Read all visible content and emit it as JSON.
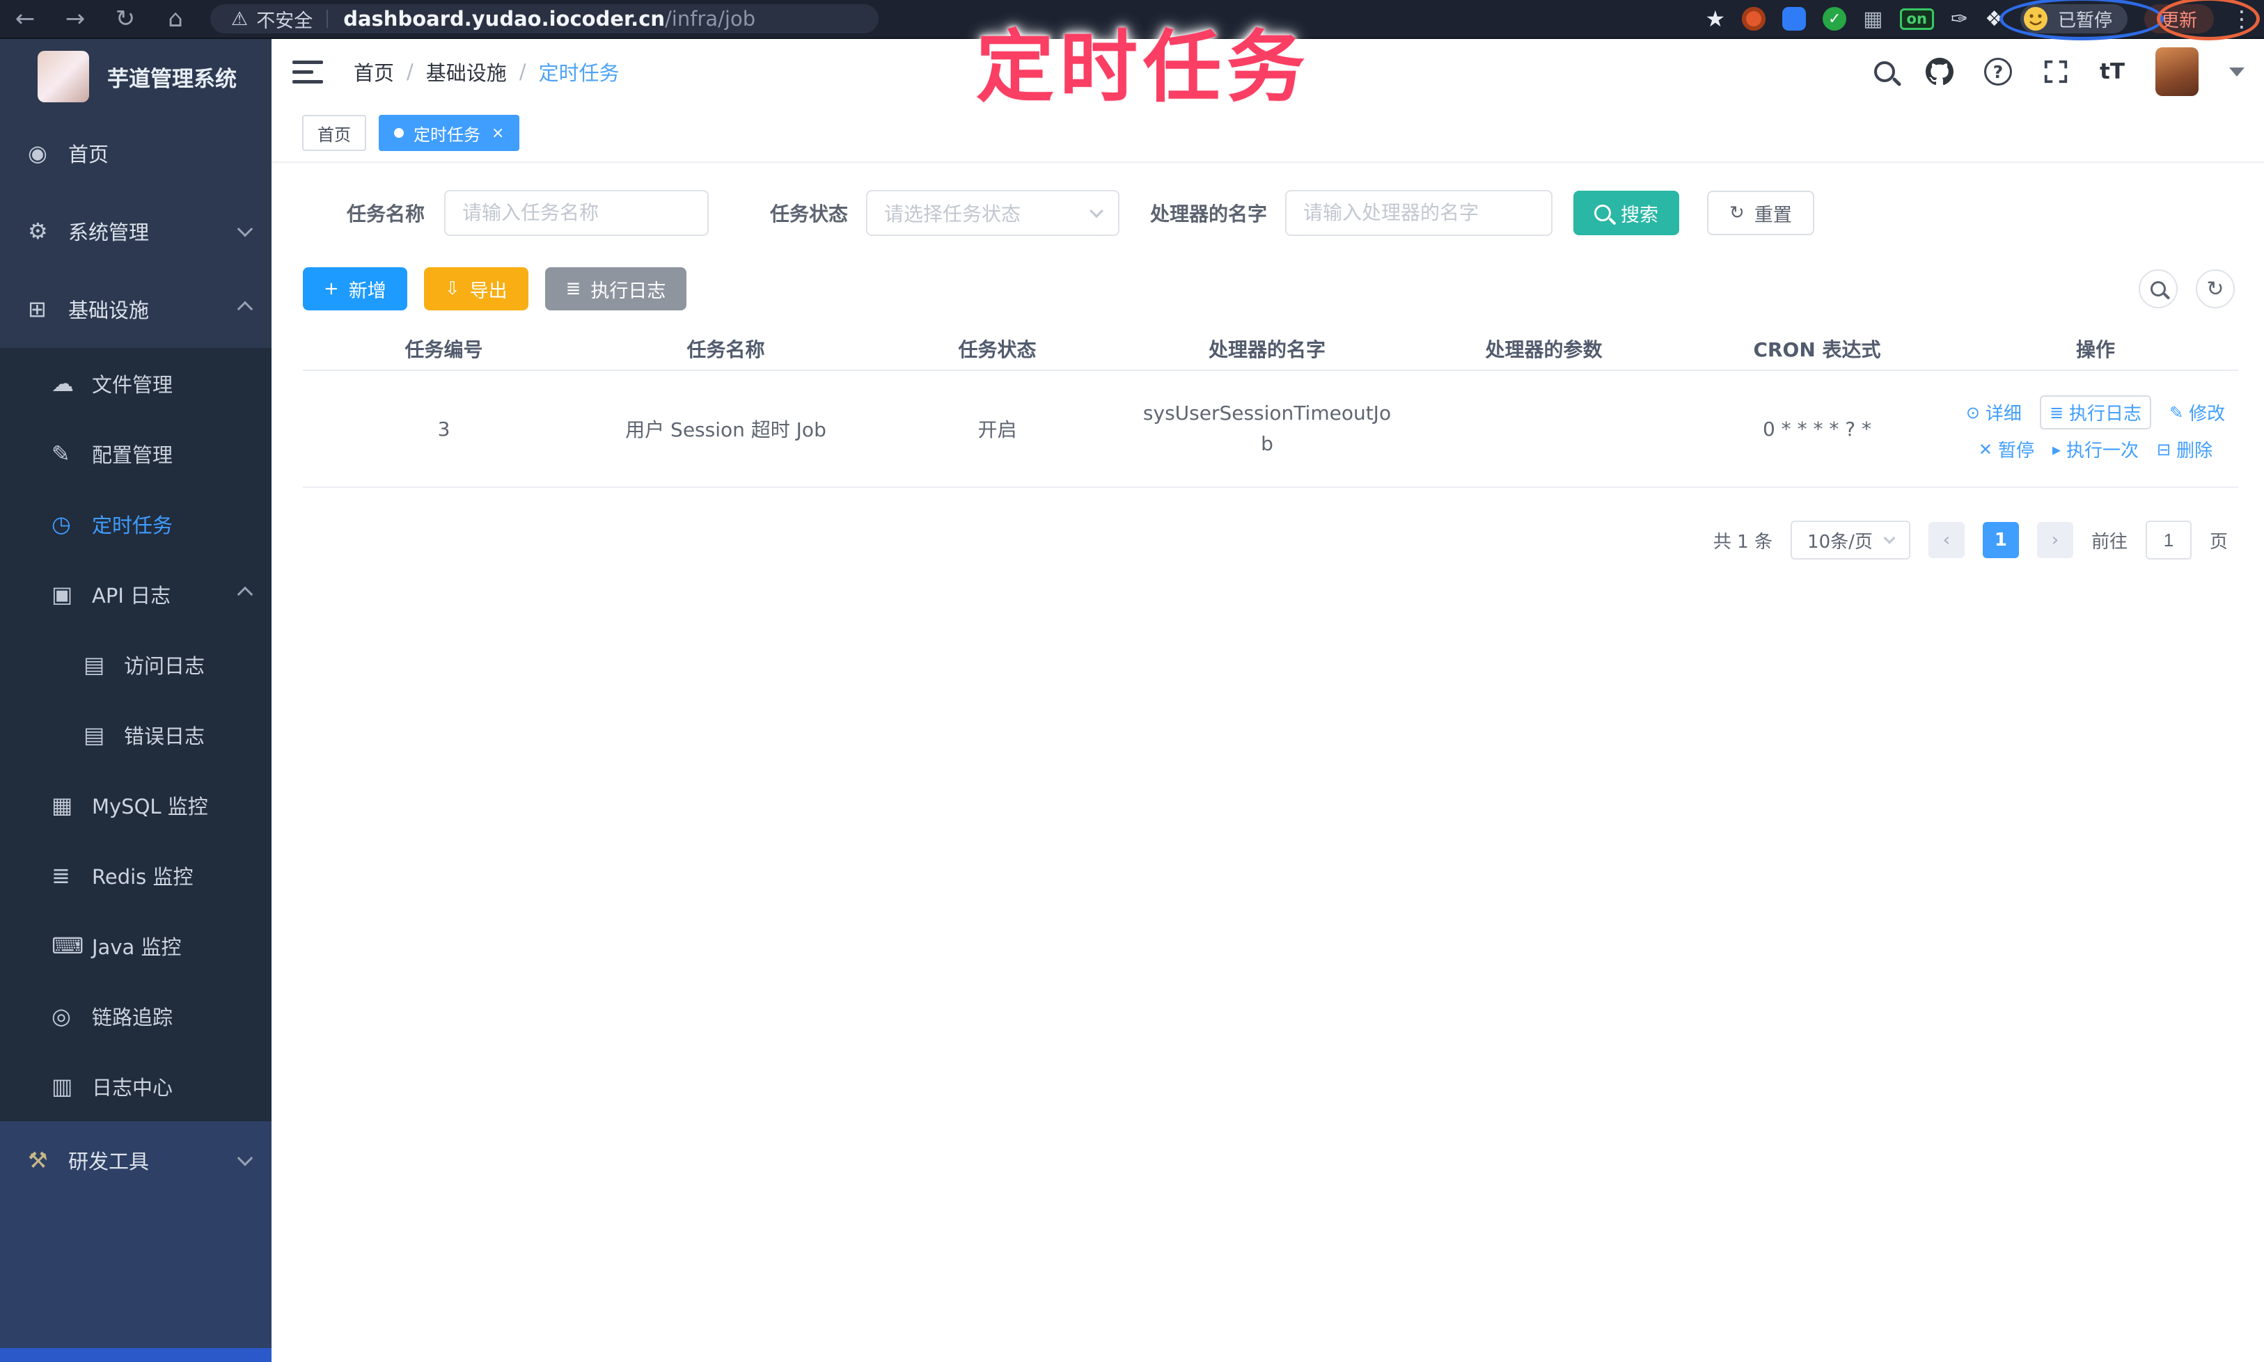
{
  "colors": {
    "primary": "#409eff",
    "search_teal": "#2ab7a5",
    "export_yellow": "#f9ae13",
    "info_gray": "#8f959f",
    "annotation_pink": "#fb3e63",
    "sidebar_bg": "#2c3950",
    "sidebar_sub_bg": "#212c3d"
  },
  "annotation": {
    "title": "定时任务"
  },
  "browser": {
    "security_label": "不安全",
    "url_host": "dashboard.yudao.iocoder.cn",
    "url_path": "/infra/job",
    "on_badge": "on",
    "profile_status": "已暂停",
    "update_label": "更新"
  },
  "sidebar": {
    "app_title": "芋道管理系统",
    "items": [
      {
        "icon": "◉",
        "label": "首页"
      },
      {
        "icon": "⚙",
        "label": "系统管理"
      },
      {
        "icon": "⊞",
        "label": "基础设施"
      },
      {
        "icon": "☁",
        "label": "文件管理"
      },
      {
        "icon": "✎",
        "label": "配置管理"
      },
      {
        "icon": "◷",
        "label": "定时任务"
      },
      {
        "icon": "▣",
        "label": "API 日志"
      },
      {
        "icon": "▤",
        "label": "访问日志"
      },
      {
        "icon": "▤",
        "label": "错误日志"
      },
      {
        "icon": "▦",
        "label": "MySQL 监控"
      },
      {
        "icon": "≣",
        "label": "Redis 监控"
      },
      {
        "icon": "⌨",
        "label": "Java 监控"
      },
      {
        "icon": "◎",
        "label": "链路追踪"
      },
      {
        "icon": "▥",
        "label": "日志中心"
      },
      {
        "icon": "⚒",
        "label": "研发工具"
      }
    ]
  },
  "header": {
    "breadcrumb": [
      "首页",
      "基础设施",
      "定时任务"
    ],
    "text_size_label": "tT"
  },
  "tags": {
    "items": [
      {
        "label": "首页"
      },
      {
        "label": "定时任务"
      }
    ]
  },
  "filters": {
    "name_label": "任务名称",
    "name_placeholder": "请输入任务名称",
    "status_label": "任务状态",
    "status_placeholder": "请选择任务状态",
    "handler_label": "处理器的名字",
    "handler_placeholder": "请输入处理器的名字",
    "search_label": "搜索",
    "reset_label": "重置"
  },
  "toolbar": {
    "add_label": "新增",
    "export_label": "导出",
    "exec_log_label": "执行日志"
  },
  "table": {
    "headers": [
      "任务编号",
      "任务名称",
      "任务状态",
      "处理器的名字",
      "处理器的参数",
      "CRON 表达式",
      "操作"
    ],
    "row": {
      "id": "3",
      "name": "用户 Session 超时 Job",
      "status": "开启",
      "handler": "sysUserSessionTimeoutJob",
      "param": "",
      "cron": "0 * * * * ? *"
    },
    "actions": [
      {
        "icon": "⊙",
        "label": "详细"
      },
      {
        "icon": "≣",
        "label": "执行日志"
      },
      {
        "icon": "✎",
        "label": "修改"
      },
      {
        "icon": "✕",
        "label": "暂停"
      },
      {
        "icon": "▸",
        "label": "执行一次"
      },
      {
        "icon": "⊟",
        "label": "删除"
      }
    ]
  },
  "pagination": {
    "total": "共 1 条",
    "size": "10条/页",
    "current": "1",
    "jump_prefix": "前往",
    "jump_value": "1",
    "jump_suffix": "页"
  }
}
